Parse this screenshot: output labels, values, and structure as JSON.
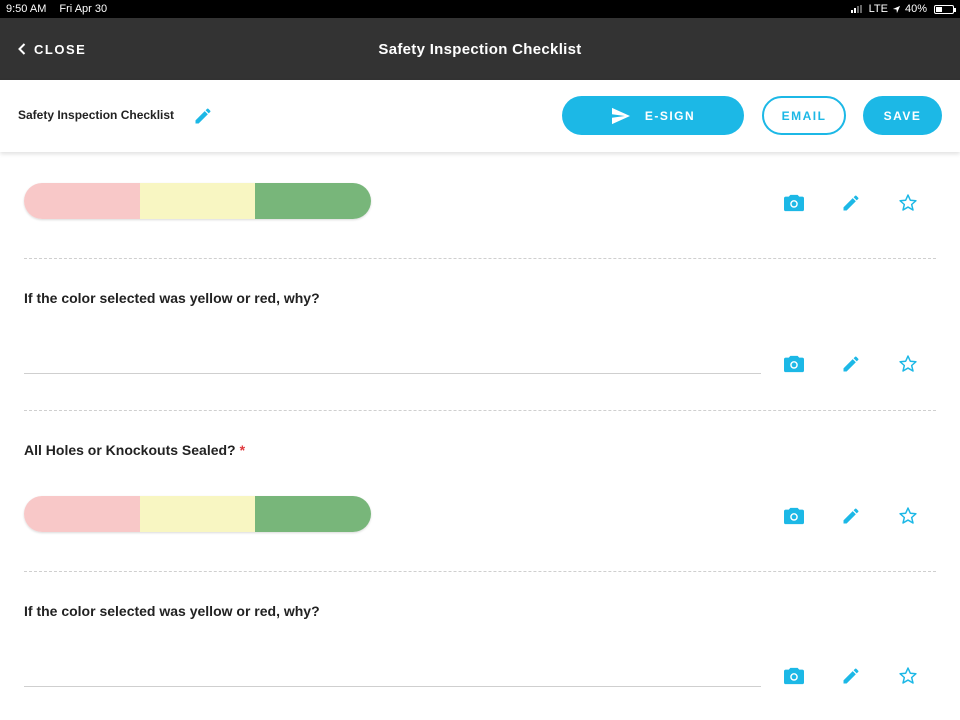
{
  "status_bar": {
    "time": "9:50 AM",
    "date": "Fri Apr 30",
    "network": "LTE",
    "battery": "40%",
    "battery_level": 0.4
  },
  "nav": {
    "close_label": "CLOSE",
    "title": "Safety Inspection Checklist"
  },
  "toolbar": {
    "doc_title": "Safety Inspection Checklist",
    "esign_label": "E-SIGN",
    "email_label": "EMAIL",
    "save_label": "SAVE"
  },
  "colors": {
    "accent": "#1cb8e6",
    "red": "#f8c8c8",
    "yellow": "#f8f6c2",
    "green": "#78b67a",
    "required": "#e0393e",
    "header": "#333333"
  },
  "items": [
    {
      "type": "color-rating",
      "options": [
        "red",
        "yellow",
        "green"
      ]
    },
    {
      "type": "text",
      "question": "If the color selected was yellow or red, why?"
    },
    {
      "type": "color-rating",
      "question": "All Holes or Knockouts Sealed?",
      "required_mark": "*",
      "options": [
        "red",
        "yellow",
        "green"
      ]
    },
    {
      "type": "text",
      "question": "If the color selected was yellow or red, why?"
    }
  ],
  "item_icons": [
    "camera-icon",
    "pencil-icon",
    "star-icon"
  ]
}
